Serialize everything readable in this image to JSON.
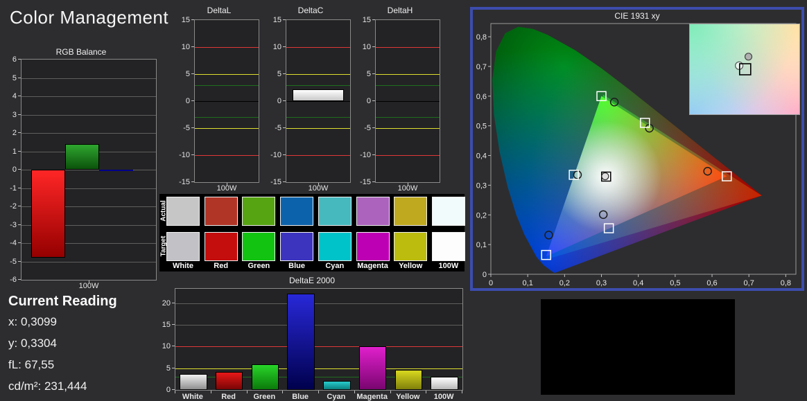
{
  "page": {
    "title": "Color Management",
    "background": "#2d2d30",
    "accent_border": "#3c4cad"
  },
  "current_reading": {
    "title": "Current Reading",
    "lines": [
      "x: 0,3099",
      "y: 0,3304",
      "fL: 67,55",
      "cd/m²: 231,444"
    ]
  },
  "swatch_table": {
    "row_labels": [
      "Actual",
      "Target"
    ],
    "columns": [
      "White",
      "Red",
      "Green",
      "Blue",
      "Cyan",
      "Magenta",
      "Yellow",
      "100W"
    ],
    "actual_colors": [
      "#c6c6c6",
      "#b13527",
      "#56a411",
      "#0d63ab",
      "#46b9bf",
      "#ab63bd",
      "#bfa91e",
      "#f2fbfb"
    ],
    "target_colors": [
      "#c2c2c6",
      "#c40d0d",
      "#12c312",
      "#3c34bf",
      "#00c3c9",
      "#bd00b3",
      "#bcbc0e",
      "#fdfdfd"
    ]
  },
  "chart_data": [
    {
      "id": "rgb_balance",
      "type": "bar",
      "title": "RGB Balance",
      "xlabel": "100W",
      "ylim": [
        -6,
        6
      ],
      "yticks": [
        6,
        5,
        4,
        3,
        2,
        1,
        0,
        -1,
        -2,
        -3,
        -4,
        -5,
        -6
      ],
      "gridlines": [
        -5,
        -4,
        -3,
        -2,
        -1,
        0,
        1,
        2,
        3,
        4,
        5
      ],
      "series": [
        {
          "name": "Red",
          "value": -4.8,
          "color_top": "#ff2626",
          "color_bottom": "#950000"
        },
        {
          "name": "Green",
          "value": 1.4,
          "color_top": "#2fa62f",
          "color_bottom": "#0b520b"
        },
        {
          "name": "Blue",
          "value": -0.07,
          "color_top": "#00008b",
          "color_bottom": "#00008b"
        }
      ]
    },
    {
      "id": "deltaL",
      "type": "bar",
      "title": "DeltaL",
      "xlabel": "100W",
      "ylim": [
        -15,
        15
      ],
      "yticks": [
        15,
        10,
        5,
        0,
        -5,
        -10,
        -15
      ],
      "zero_line": "#000000",
      "reference_lines": [
        {
          "value": 10,
          "color": "#e03838"
        },
        {
          "value": 5,
          "color": "#e0e030"
        },
        {
          "value": 3,
          "color": "#1e6e1e"
        },
        {
          "value": -3,
          "color": "#1e6e1e"
        },
        {
          "value": -5,
          "color": "#e0e030"
        },
        {
          "value": -10,
          "color": "#e03838"
        }
      ],
      "series": []
    },
    {
      "id": "deltaC",
      "type": "bar",
      "title": "DeltaC",
      "xlabel": "100W",
      "ylim": [
        -15,
        15
      ],
      "yticks": [
        15,
        10,
        5,
        0,
        -5,
        -10,
        -15
      ],
      "zero_line": "#000000",
      "reference_lines": [
        {
          "value": 10,
          "color": "#e03838"
        },
        {
          "value": 5,
          "color": "#e0e030"
        },
        {
          "value": 3,
          "color": "#1e6e1e"
        },
        {
          "value": -3,
          "color": "#1e6e1e"
        },
        {
          "value": -5,
          "color": "#e0e030"
        },
        {
          "value": -10,
          "color": "#e03838"
        }
      ],
      "series": [
        {
          "name": "100W",
          "value": 2.2,
          "color_top": "#ffffff",
          "color_bottom": "#c8c8c8"
        }
      ]
    },
    {
      "id": "deltaH",
      "type": "bar",
      "title": "DeltaH",
      "xlabel": "100W",
      "ylim": [
        -15,
        15
      ],
      "yticks": [
        15,
        10,
        5,
        0,
        -5,
        -10,
        -15
      ],
      "zero_line": "#000000",
      "reference_lines": [
        {
          "value": 10,
          "color": "#e03838"
        },
        {
          "value": 5,
          "color": "#e0e030"
        },
        {
          "value": 3,
          "color": "#1e6e1e"
        },
        {
          "value": -3,
          "color": "#1e6e1e"
        },
        {
          "value": -5,
          "color": "#e0e030"
        },
        {
          "value": -10,
          "color": "#e03838"
        }
      ],
      "series": []
    },
    {
      "id": "deltaE2000",
      "type": "bar",
      "title": "DeltaE 2000",
      "categories": [
        "White",
        "Red",
        "Green",
        "Blue",
        "Cyan",
        "Magenta",
        "Yellow",
        "100W"
      ],
      "values": [
        3.7,
        4.2,
        5.9,
        22.2,
        2.1,
        10.0,
        4.7,
        3.0
      ],
      "bar_colors": [
        [
          "#f0f0f0",
          "#8f8f8f"
        ],
        [
          "#e81818",
          "#7a0505"
        ],
        [
          "#28d428",
          "#0b7a0b"
        ],
        [
          "#2828d8",
          "#00004d"
        ],
        [
          "#28cccc",
          "#0b8080"
        ],
        [
          "#e020cc",
          "#7a0570"
        ],
        [
          "#d8d820",
          "#80800b"
        ],
        [
          "#ffffff",
          "#b8b8b8"
        ]
      ],
      "ylim": [
        0,
        23.3
      ],
      "yticks": [
        20,
        15,
        10,
        5,
        0
      ],
      "gridlines": [
        5,
        10,
        15,
        20
      ],
      "reference_lines": [
        {
          "value": 10,
          "color": "#e03838"
        },
        {
          "value": 5,
          "color": "#e0e030"
        },
        {
          "value": 3,
          "color": "#1e6e1e"
        }
      ]
    },
    {
      "id": "cie",
      "type": "scatter",
      "title": "CIE 1931 xy",
      "xlim": [
        0,
        0.8275
      ],
      "ylim": [
        0,
        0.8445
      ],
      "xticks": [
        {
          "v": 0,
          "label": "0"
        },
        {
          "v": 0.1,
          "label": "0,1"
        },
        {
          "v": 0.2,
          "label": "0,2"
        },
        {
          "v": 0.3,
          "label": "0,3"
        },
        {
          "v": 0.4,
          "label": "0,4"
        },
        {
          "v": 0.5,
          "label": "0,5"
        },
        {
          "v": 0.6,
          "label": "0,6"
        },
        {
          "v": 0.7,
          "label": "0,7"
        },
        {
          "v": 0.8,
          "label": "0,8"
        }
      ],
      "yticks": [
        {
          "v": 0,
          "label": "0"
        },
        {
          "v": 0.1,
          "label": "0,1"
        },
        {
          "v": 0.2,
          "label": "0,2"
        },
        {
          "v": 0.3,
          "label": "0,3"
        },
        {
          "v": 0.4,
          "label": "0,4"
        },
        {
          "v": 0.5,
          "label": "0,5"
        },
        {
          "v": 0.6,
          "label": "0,6"
        },
        {
          "v": 0.7,
          "label": "0,7"
        },
        {
          "v": 0.8,
          "label": "0,8"
        }
      ],
      "gamut_target": [
        [
          0.64,
          0.33
        ],
        [
          0.3,
          0.6
        ],
        [
          0.15,
          0.06
        ]
      ],
      "gamut_native": [
        [
          0.735,
          0.265
        ],
        [
          0.305,
          0.605
        ],
        [
          0.15,
          0.05
        ]
      ],
      "targets": [
        {
          "name": "green",
          "x": 0.3,
          "y": 0.6
        },
        {
          "name": "yellow",
          "x": 0.418,
          "y": 0.51
        },
        {
          "name": "red",
          "x": 0.64,
          "y": 0.33
        },
        {
          "name": "cyan",
          "x": 0.225,
          "y": 0.335
        },
        {
          "name": "magenta",
          "x": 0.32,
          "y": 0.155
        },
        {
          "name": "blue",
          "x": 0.15,
          "y": 0.065
        }
      ],
      "white_target": {
        "x": 0.3127,
        "y": 0.329
      },
      "measured": [
        {
          "name": "green",
          "x": 0.335,
          "y": 0.58
        },
        {
          "name": "yellow",
          "x": 0.43,
          "y": 0.492
        },
        {
          "name": "red",
          "x": 0.588,
          "y": 0.347
        },
        {
          "name": "cyan",
          "x": 0.235,
          "y": 0.335
        },
        {
          "name": "magenta",
          "x": 0.305,
          "y": 0.201
        },
        {
          "name": "blue",
          "x": 0.157,
          "y": 0.132
        }
      ],
      "white_measured": {
        "x": 0.31,
        "y": 0.33
      },
      "inset": {
        "markers": [
          {
            "type": "circle-filled",
            "fx": 0.535,
            "fy": 0.36
          },
          {
            "type": "circle-open",
            "fx": 0.45,
            "fy": 0.46
          },
          {
            "type": "square",
            "fx": 0.505,
            "fy": 0.5
          }
        ]
      }
    }
  ]
}
